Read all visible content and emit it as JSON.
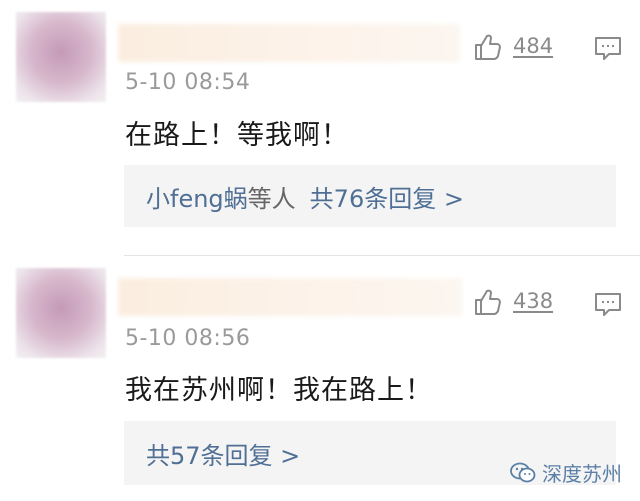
{
  "comments": [
    {
      "likes": "484",
      "time": "5-10 08:54",
      "content": "在路上！等我啊！",
      "reply_users": "小feng蜗",
      "reply_users_suffix": "等人",
      "reply_count_text": "共76条回复 >"
    },
    {
      "likes": "438",
      "time": "5-10 08:56",
      "content": "我在苏州啊！我在路上！",
      "reply_count_text": "共57条回复 >"
    }
  ],
  "watermark": {
    "text": "深度苏州",
    "icon": "wechat-icon"
  },
  "icons": {
    "like": "thumbs-up-icon",
    "reply": "comment-icon"
  },
  "colors": {
    "link": "#4f6f95",
    "time": "#9a9a9a",
    "reply_bg": "#f4f4f4"
  }
}
